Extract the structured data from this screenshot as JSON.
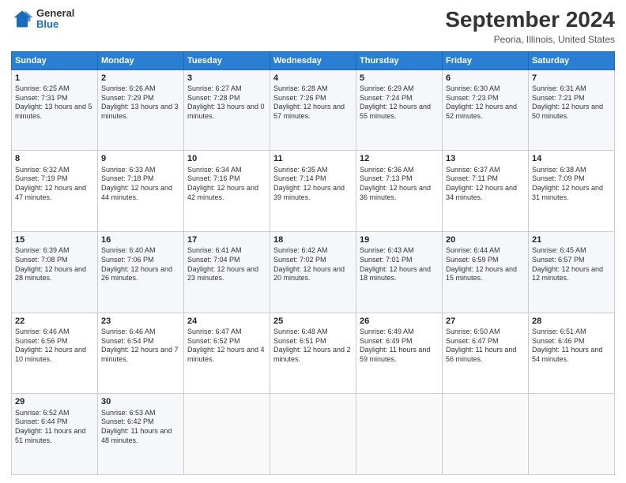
{
  "header": {
    "logo_general": "General",
    "logo_blue": "Blue",
    "month": "September 2024",
    "location": "Peoria, Illinois, United States"
  },
  "calendar": {
    "days": [
      "Sunday",
      "Monday",
      "Tuesday",
      "Wednesday",
      "Thursday",
      "Friday",
      "Saturday"
    ],
    "weeks": [
      [
        null,
        {
          "day": 2,
          "sunrise": "Sunrise: 6:26 AM",
          "sunset": "Sunset: 7:29 PM",
          "daylight": "Daylight: 13 hours and 3 minutes."
        },
        {
          "day": 3,
          "sunrise": "Sunrise: 6:27 AM",
          "sunset": "Sunset: 7:28 PM",
          "daylight": "Daylight: 13 hours and 0 minutes."
        },
        {
          "day": 4,
          "sunrise": "Sunrise: 6:28 AM",
          "sunset": "Sunset: 7:26 PM",
          "daylight": "Daylight: 12 hours and 57 minutes."
        },
        {
          "day": 5,
          "sunrise": "Sunrise: 6:29 AM",
          "sunset": "Sunset: 7:24 PM",
          "daylight": "Daylight: 12 hours and 55 minutes."
        },
        {
          "day": 6,
          "sunrise": "Sunrise: 6:30 AM",
          "sunset": "Sunset: 7:23 PM",
          "daylight": "Daylight: 12 hours and 52 minutes."
        },
        {
          "day": 7,
          "sunrise": "Sunrise: 6:31 AM",
          "sunset": "Sunset: 7:21 PM",
          "daylight": "Daylight: 12 hours and 50 minutes."
        }
      ],
      [
        {
          "day": 1,
          "sunrise": "Sunrise: 6:25 AM",
          "sunset": "Sunset: 7:31 PM",
          "daylight": "Daylight: 13 hours and 5 minutes."
        },
        {
          "day": 8,
          "sunrise": "Sunrise: 6:32 AM",
          "sunset": "Sunset: 7:19 PM",
          "daylight": "Daylight: 12 hours and 47 minutes."
        },
        {
          "day": 9,
          "sunrise": "Sunrise: 6:33 AM",
          "sunset": "Sunset: 7:18 PM",
          "daylight": "Daylight: 12 hours and 44 minutes."
        },
        {
          "day": 10,
          "sunrise": "Sunrise: 6:34 AM",
          "sunset": "Sunset: 7:16 PM",
          "daylight": "Daylight: 12 hours and 42 minutes."
        },
        {
          "day": 11,
          "sunrise": "Sunrise: 6:35 AM",
          "sunset": "Sunset: 7:14 PM",
          "daylight": "Daylight: 12 hours and 39 minutes."
        },
        {
          "day": 12,
          "sunrise": "Sunrise: 6:36 AM",
          "sunset": "Sunset: 7:13 PM",
          "daylight": "Daylight: 12 hours and 36 minutes."
        },
        {
          "day": 13,
          "sunrise": "Sunrise: 6:37 AM",
          "sunset": "Sunset: 7:11 PM",
          "daylight": "Daylight: 12 hours and 34 minutes."
        },
        {
          "day": 14,
          "sunrise": "Sunrise: 6:38 AM",
          "sunset": "Sunset: 7:09 PM",
          "daylight": "Daylight: 12 hours and 31 minutes."
        }
      ],
      [
        {
          "day": 15,
          "sunrise": "Sunrise: 6:39 AM",
          "sunset": "Sunset: 7:08 PM",
          "daylight": "Daylight: 12 hours and 28 minutes."
        },
        {
          "day": 16,
          "sunrise": "Sunrise: 6:40 AM",
          "sunset": "Sunset: 7:06 PM",
          "daylight": "Daylight: 12 hours and 26 minutes."
        },
        {
          "day": 17,
          "sunrise": "Sunrise: 6:41 AM",
          "sunset": "Sunset: 7:04 PM",
          "daylight": "Daylight: 12 hours and 23 minutes."
        },
        {
          "day": 18,
          "sunrise": "Sunrise: 6:42 AM",
          "sunset": "Sunset: 7:02 PM",
          "daylight": "Daylight: 12 hours and 20 minutes."
        },
        {
          "day": 19,
          "sunrise": "Sunrise: 6:43 AM",
          "sunset": "Sunset: 7:01 PM",
          "daylight": "Daylight: 12 hours and 18 minutes."
        },
        {
          "day": 20,
          "sunrise": "Sunrise: 6:44 AM",
          "sunset": "Sunset: 6:59 PM",
          "daylight": "Daylight: 12 hours and 15 minutes."
        },
        {
          "day": 21,
          "sunrise": "Sunrise: 6:45 AM",
          "sunset": "Sunset: 6:57 PM",
          "daylight": "Daylight: 12 hours and 12 minutes."
        }
      ],
      [
        {
          "day": 22,
          "sunrise": "Sunrise: 6:46 AM",
          "sunset": "Sunset: 6:56 PM",
          "daylight": "Daylight: 12 hours and 10 minutes."
        },
        {
          "day": 23,
          "sunrise": "Sunrise: 6:46 AM",
          "sunset": "Sunset: 6:54 PM",
          "daylight": "Daylight: 12 hours and 7 minutes."
        },
        {
          "day": 24,
          "sunrise": "Sunrise: 6:47 AM",
          "sunset": "Sunset: 6:52 PM",
          "daylight": "Daylight: 12 hours and 4 minutes."
        },
        {
          "day": 25,
          "sunrise": "Sunrise: 6:48 AM",
          "sunset": "Sunset: 6:51 PM",
          "daylight": "Daylight: 12 hours and 2 minutes."
        },
        {
          "day": 26,
          "sunrise": "Sunrise: 6:49 AM",
          "sunset": "Sunset: 6:49 PM",
          "daylight": "Daylight: 11 hours and 59 minutes."
        },
        {
          "day": 27,
          "sunrise": "Sunrise: 6:50 AM",
          "sunset": "Sunset: 6:47 PM",
          "daylight": "Daylight: 11 hours and 56 minutes."
        },
        {
          "day": 28,
          "sunrise": "Sunrise: 6:51 AM",
          "sunset": "Sunset: 6:46 PM",
          "daylight": "Daylight: 11 hours and 54 minutes."
        }
      ],
      [
        {
          "day": 29,
          "sunrise": "Sunrise: 6:52 AM",
          "sunset": "Sunset: 6:44 PM",
          "daylight": "Daylight: 11 hours and 51 minutes."
        },
        {
          "day": 30,
          "sunrise": "Sunrise: 6:53 AM",
          "sunset": "Sunset: 6:42 PM",
          "daylight": "Daylight: 11 hours and 48 minutes."
        },
        null,
        null,
        null,
        null,
        null
      ]
    ]
  }
}
